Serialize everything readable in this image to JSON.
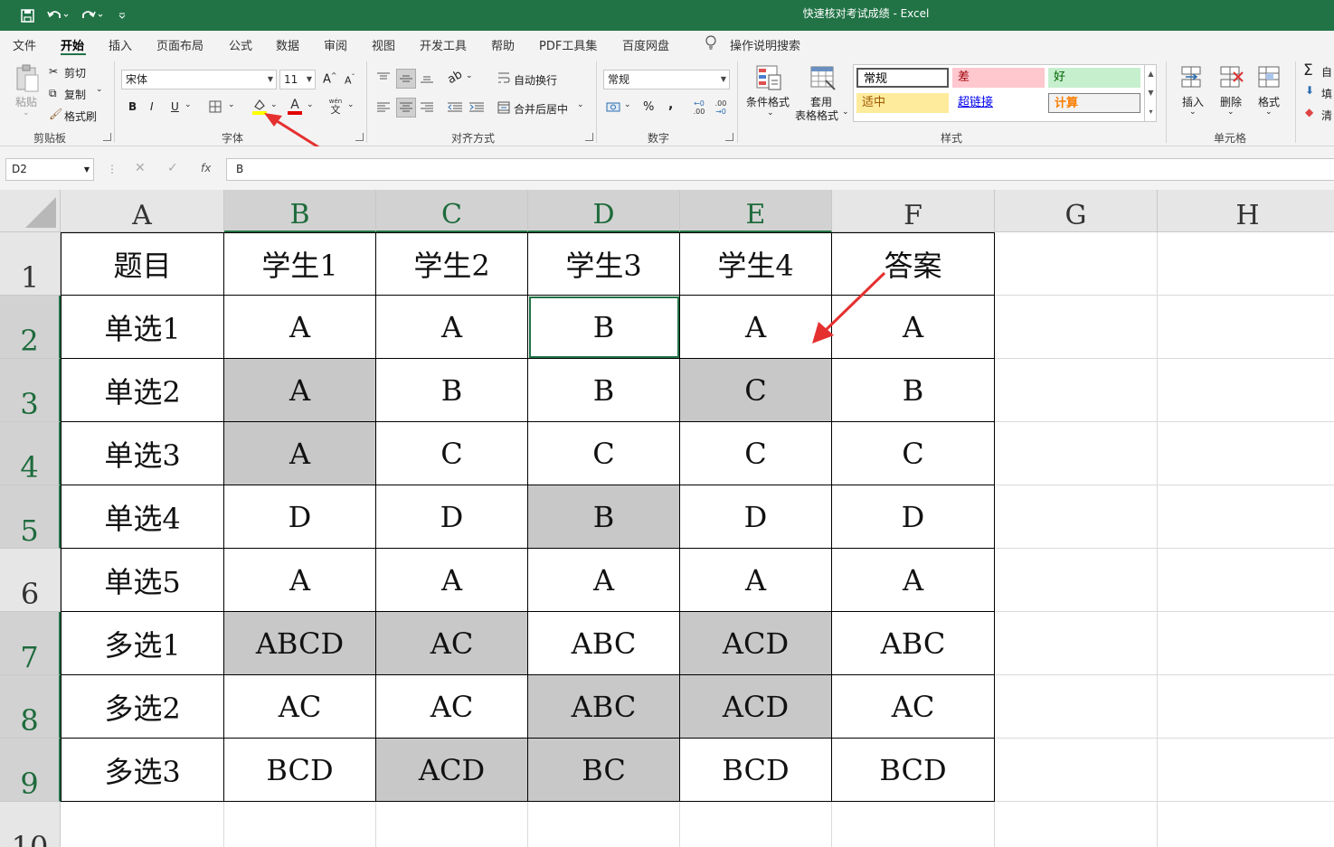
{
  "app": {
    "title": "快速核对考试成绩  -  Excel",
    "quick_access": [
      "save-icon",
      "undo-icon",
      "redo-icon",
      "customize-icon"
    ]
  },
  "menu": {
    "tabs": [
      "文件",
      "开始",
      "插入",
      "页面布局",
      "公式",
      "数据",
      "审阅",
      "视图",
      "开发工具",
      "帮助",
      "PDF工具集",
      "百度网盘"
    ],
    "active": "开始",
    "tell_me": "操作说明搜索"
  },
  "ribbon": {
    "clipboard": {
      "paste": "粘贴",
      "cut": "剪切",
      "copy": "复制",
      "format_painter": "格式刷",
      "label": "剪贴板"
    },
    "font": {
      "name": "宋体",
      "size": "11",
      "bold": "B",
      "italic": "I",
      "underline": "U",
      "grow": "A",
      "shrink": "A",
      "font_color_glyph": "A",
      "phonetic": "wén",
      "phonetic_glyph": "文",
      "label": "字体",
      "fill_color": "#ffff00",
      "font_color": "#e00000"
    },
    "alignment": {
      "wrap": "自动换行",
      "merge": "合并后居中",
      "label": "对齐方式"
    },
    "number": {
      "format": "常规",
      "percent": "%",
      "comma": ",",
      "inc_decimal": ".00",
      "dec_decimal": ".00",
      "label": "数字"
    },
    "styles": {
      "conditional": "条件格式",
      "table_line1": "套用",
      "table_line2": "表格格式",
      "cells": [
        {
          "text": "常规",
          "bg": "#ffffff",
          "fg": "#000000"
        },
        {
          "text": "差",
          "bg": "#ffc7ce",
          "fg": "#9c0006"
        },
        {
          "text": "好",
          "bg": "#c6efce",
          "fg": "#006100"
        },
        {
          "text": "适中",
          "bg": "#ffeb9c",
          "fg": "#9c5700"
        },
        {
          "text": "超链接",
          "bg": "#ffffff",
          "fg": "#0000ee"
        },
        {
          "text": "计算",
          "bg": "#f2f2f2",
          "fg": "#fa7d00"
        }
      ],
      "label": "样式"
    },
    "cells_group": {
      "insert": "插入",
      "delete": "删除",
      "format": "格式",
      "label": "单元格"
    },
    "editing": {
      "sum_glyph": "Σ",
      "autosum": "自",
      "fill": "填",
      "clear": "清"
    }
  },
  "formula_bar": {
    "name_box": "D2",
    "fx": "fx",
    "value": "B"
  },
  "sheet": {
    "columns": [
      "A",
      "B",
      "C",
      "D",
      "E",
      "F",
      "G",
      "H"
    ],
    "rows": [
      "1",
      "2",
      "3",
      "4",
      "5",
      "6",
      "7",
      "8",
      "9",
      "10"
    ],
    "data": [
      [
        "题目",
        "学生1",
        "学生2",
        "学生3",
        "学生4",
        "答案"
      ],
      [
        "单选1",
        "A",
        "A",
        "B",
        "A",
        "A"
      ],
      [
        "单选2",
        "A",
        "B",
        "B",
        "C",
        "B"
      ],
      [
        "单选3",
        "A",
        "C",
        "C",
        "C",
        "C"
      ],
      [
        "单选4",
        "D",
        "D",
        "B",
        "D",
        "D"
      ],
      [
        "单选5",
        "A",
        "A",
        "A",
        "A",
        "A"
      ],
      [
        "多选1",
        "ABCD",
        "AC",
        "ABC",
        "ACD",
        "ABC"
      ],
      [
        "多选2",
        "AC",
        "AC",
        "ABC",
        "ACD",
        "AC"
      ],
      [
        "多选3",
        "BCD",
        "ACD",
        "BC",
        "BCD",
        "BCD"
      ]
    ],
    "highlighted": [
      [
        2,
        1
      ],
      [
        2,
        4
      ],
      [
        3,
        1
      ],
      [
        4,
        3
      ],
      [
        6,
        1
      ],
      [
        6,
        2
      ],
      [
        6,
        4
      ],
      [
        7,
        3
      ],
      [
        7,
        4
      ],
      [
        8,
        2
      ],
      [
        8,
        3
      ]
    ],
    "highlight_color": "#c8c8c8",
    "active_cell": "D2",
    "selected_columns": [
      "B",
      "C",
      "D",
      "E"
    ],
    "selected_rows": [
      "2",
      "3",
      "4",
      "5",
      "7",
      "8",
      "9"
    ]
  }
}
